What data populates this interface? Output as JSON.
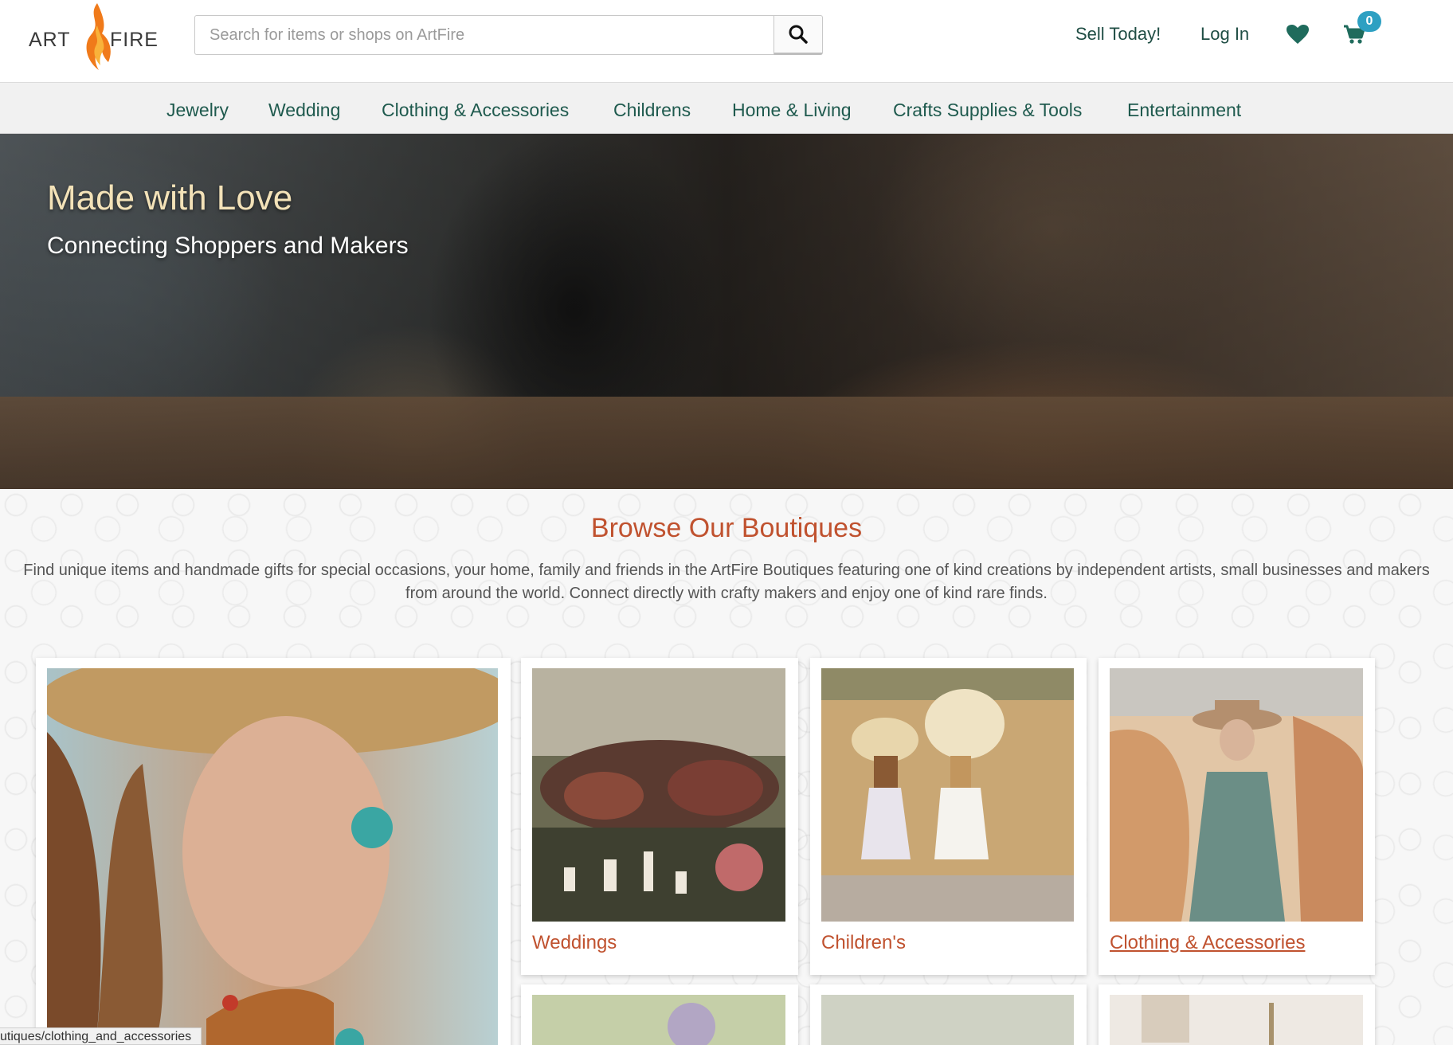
{
  "header": {
    "logo_left": "ART",
    "logo_right": "FIRE",
    "search_placeholder": "Search for items or shops on ArtFire",
    "sell_label": "Sell Today!",
    "login_label": "Log In",
    "cart_count": "0"
  },
  "categories": [
    "Jewelry",
    "Wedding",
    "Clothing & Accessories",
    "Childrens",
    "Home & Living",
    "Crafts Supplies & Tools",
    "Entertainment"
  ],
  "hero": {
    "title": "Made with Love",
    "subtitle": "Connecting Shoppers and Makers"
  },
  "boutiques": {
    "title": "Browse Our Boutiques",
    "description": "Find unique items and handmade gifts for special occasions, your home, family and friends in the ArtFire Boutiques featuring one of kind creations by independent artists, small businesses and makers from around the world. Connect directly with crafty makers and enjoy one of kind rare finds.",
    "cards": [
      {
        "label": "Weddings"
      },
      {
        "label": "Children's"
      },
      {
        "label": "Clothing & Accessories"
      }
    ]
  },
  "status_bar": {
    "url": "utiques/clothing_and_accessories"
  },
  "colors": {
    "accent": "#c0522f",
    "nav_text": "#1f5a4e",
    "badge": "#2ea0c2"
  }
}
